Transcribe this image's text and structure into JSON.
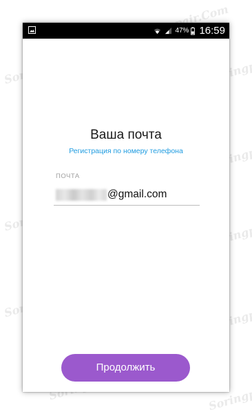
{
  "status_bar": {
    "battery_percent": "47%",
    "time": "16:59",
    "icons": [
      "image-icon",
      "wifi-icon",
      "signal-icon",
      "battery-icon"
    ]
  },
  "page": {
    "title": "Ваша почта",
    "phone_registration_link": "Регистрация по номеру телефона"
  },
  "email_field": {
    "label": "ПОЧТА",
    "value_visible": "@gmail.com",
    "value_prefix_obscured": true
  },
  "continue_button": {
    "label": "Продолжить"
  },
  "watermark": {
    "text": "Soringpcrepair.Com"
  },
  "colors": {
    "accent_button": "#9b59cd",
    "link": "#1e9be0",
    "status_bar": "#000000"
  }
}
